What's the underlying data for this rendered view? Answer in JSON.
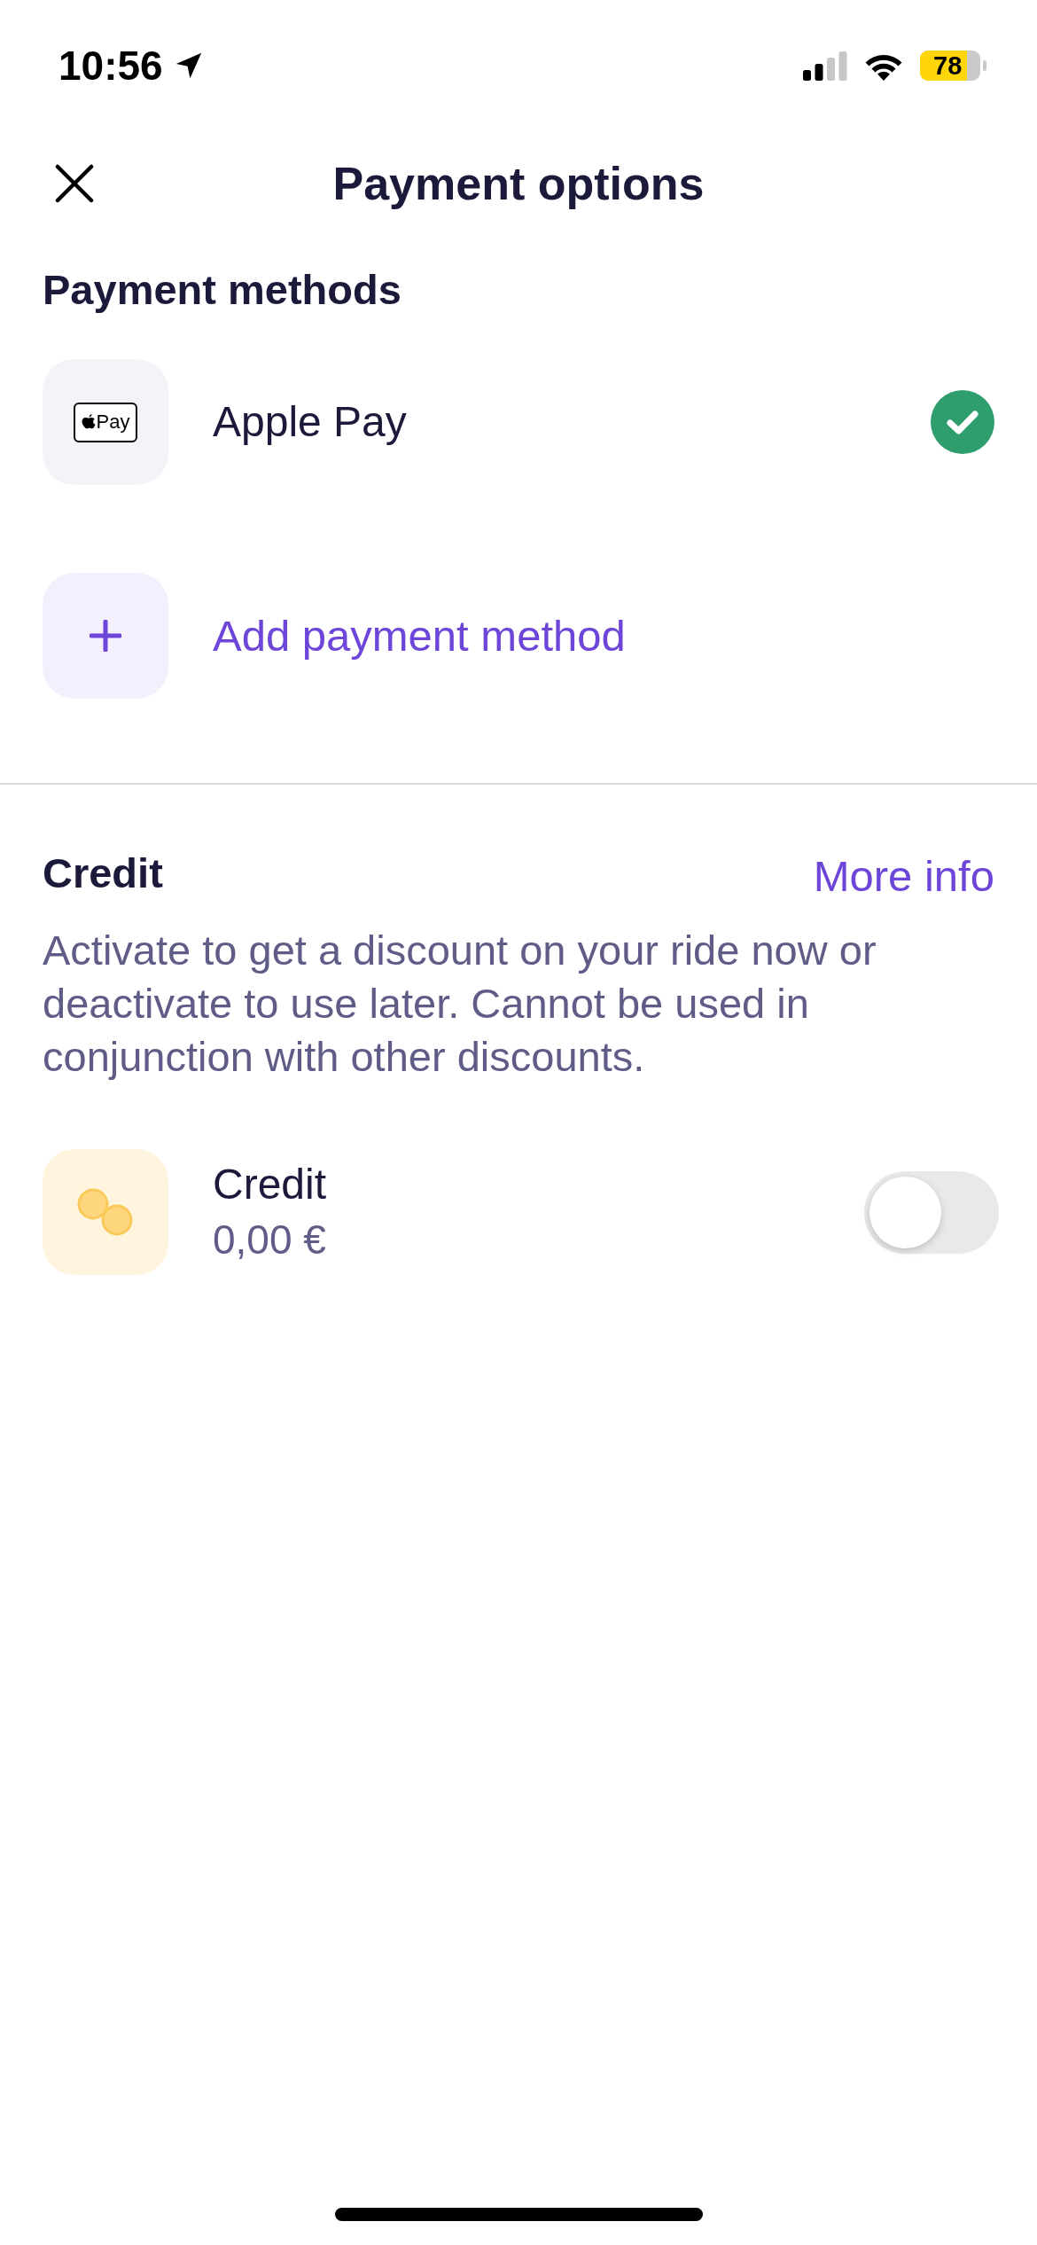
{
  "status_bar": {
    "time": "10:56",
    "battery": "78"
  },
  "header": {
    "title": "Payment options"
  },
  "payment_methods": {
    "title": "Payment methods",
    "items": [
      {
        "label": "Apple Pay",
        "logo_text": "Pay",
        "selected": true
      }
    ],
    "add_action": {
      "label": "Add payment method"
    }
  },
  "credit": {
    "title": "Credit",
    "link": "More info",
    "description": "Activate to get a discount on your ride now or deactivate to use later. Cannot be used in conjunction with other discounts.",
    "items": [
      {
        "label": "Credit",
        "amount": "0,00 €",
        "on": false
      }
    ]
  }
}
